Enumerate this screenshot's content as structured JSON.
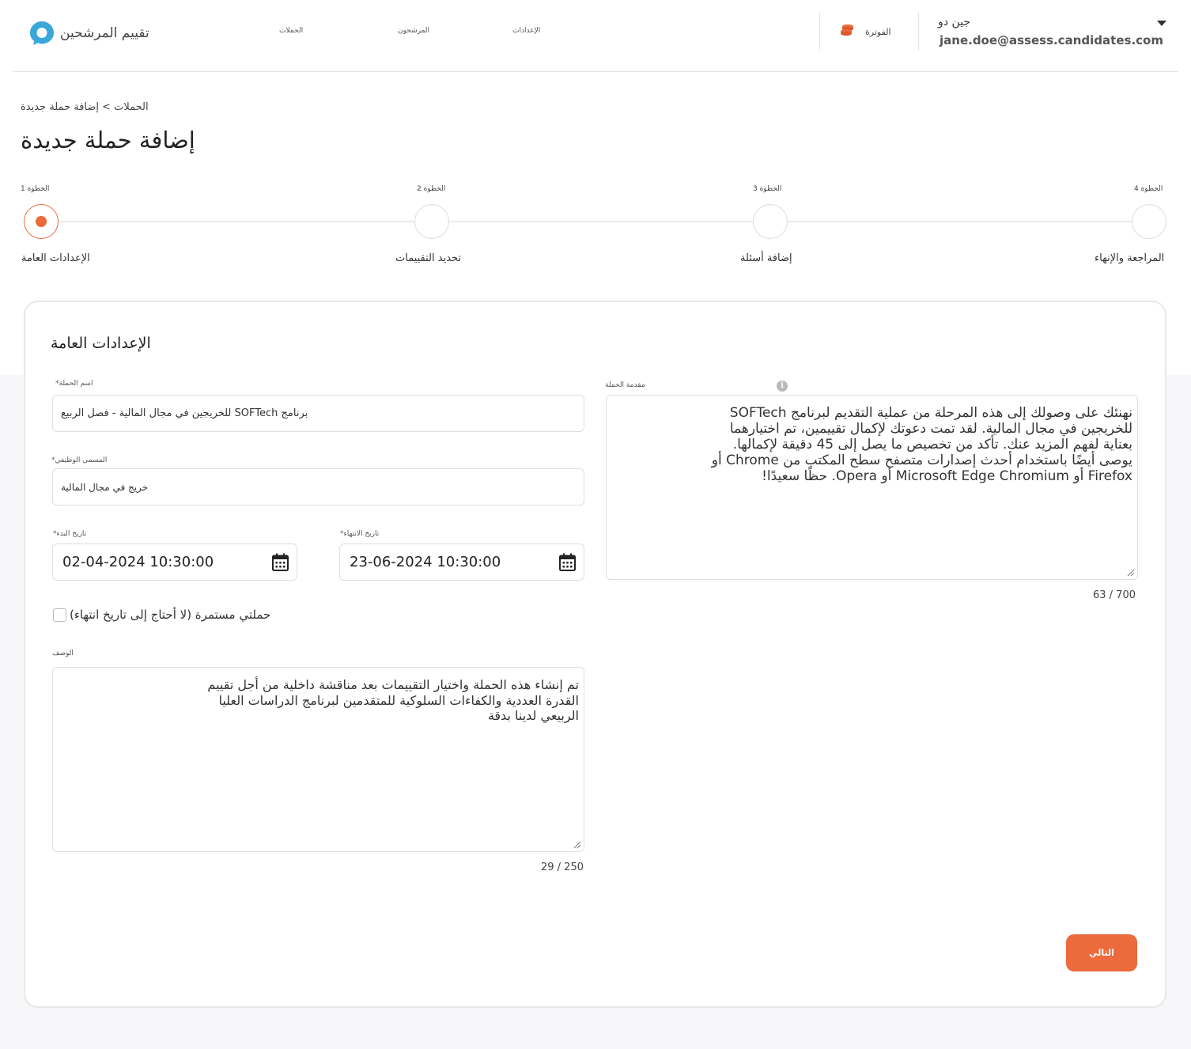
{
  "brand": {
    "name": "تقييم المرشحين"
  },
  "nav": {
    "campaigns": "الحملات",
    "candidates": "المرشحون",
    "settings": "الإعدادات"
  },
  "billing": {
    "label": "الفوترة"
  },
  "user": {
    "name": "جين دو",
    "email": "jane.doe@assess.candidates.com"
  },
  "breadcrumb": "الحملات > إضافة حملة جديدة",
  "page_title": "إضافة حملة جديدة",
  "steps": [
    {
      "small": "الخطوة 1",
      "label": "الإعدادات العامة",
      "active": true
    },
    {
      "small": "الخطوة 2",
      "label": "تحديد التقييمات",
      "active": false
    },
    {
      "small": "الخطوة 3",
      "label": "إضافة أسئلة",
      "active": false
    },
    {
      "small": "الخطوة 4",
      "label": "المراجعة والإنهاء",
      "active": false
    }
  ],
  "form": {
    "title": "الإعدادات العامة",
    "campaign_name": {
      "label": "اسم الحملة*",
      "value": "برنامج SOFTech للخريجين في مجال المالية - فصل الربيع"
    },
    "job_title": {
      "label": "المسمى الوظيفي*",
      "value": "خريج في مجال المالية"
    },
    "start_date": {
      "label": "تاريخ البدء*",
      "value": "02-04-2024 10:30:00"
    },
    "end_date": {
      "label": "تاريخ الانتهاء*",
      "value": "23-06-2024 10:30:00"
    },
    "ongoing": {
      "label": "حملتي مستمرة (لا أحتاج إلى تاريخ انتهاء)",
      "checked": false
    },
    "description": {
      "label": "الوصف",
      "value": "تم إنشاء هذه الحملة واختيار التقييمات بعد مناقشة داخلية من أجل تقييم القدرة العددية والكفاءات السلوكية للمتقدمين لبرنامج الدراسات العليا الربيعي لدينا بدقة",
      "counter": "29 / 250"
    },
    "intro": {
      "label": "مقدمة الحملة",
      "value": "نهنئك على وصولك إلى هذه المرحلة من عملية التقديم لبرنامج SOFTech للخريجين في مجال المالية. لقد تمت دعوتك لإكمال تقييمين، تم اختيارهما بعناية لفهم المزيد عنك. تأكد من تخصيص ما يصل إلى 45 دقيقة لإكمالها. يوصى أيضًا باستخدام أحدث إصدارات متصفح سطح المكتب من Chrome أو Firefox أو Microsoft Edge Chromium أو Opera. حظًا سعيدًا!",
      "counter": "63 / 700"
    },
    "next_label": "التالي"
  },
  "colors": {
    "accent": "#ec6a3c",
    "brand_blue": "#3aa6d9"
  }
}
